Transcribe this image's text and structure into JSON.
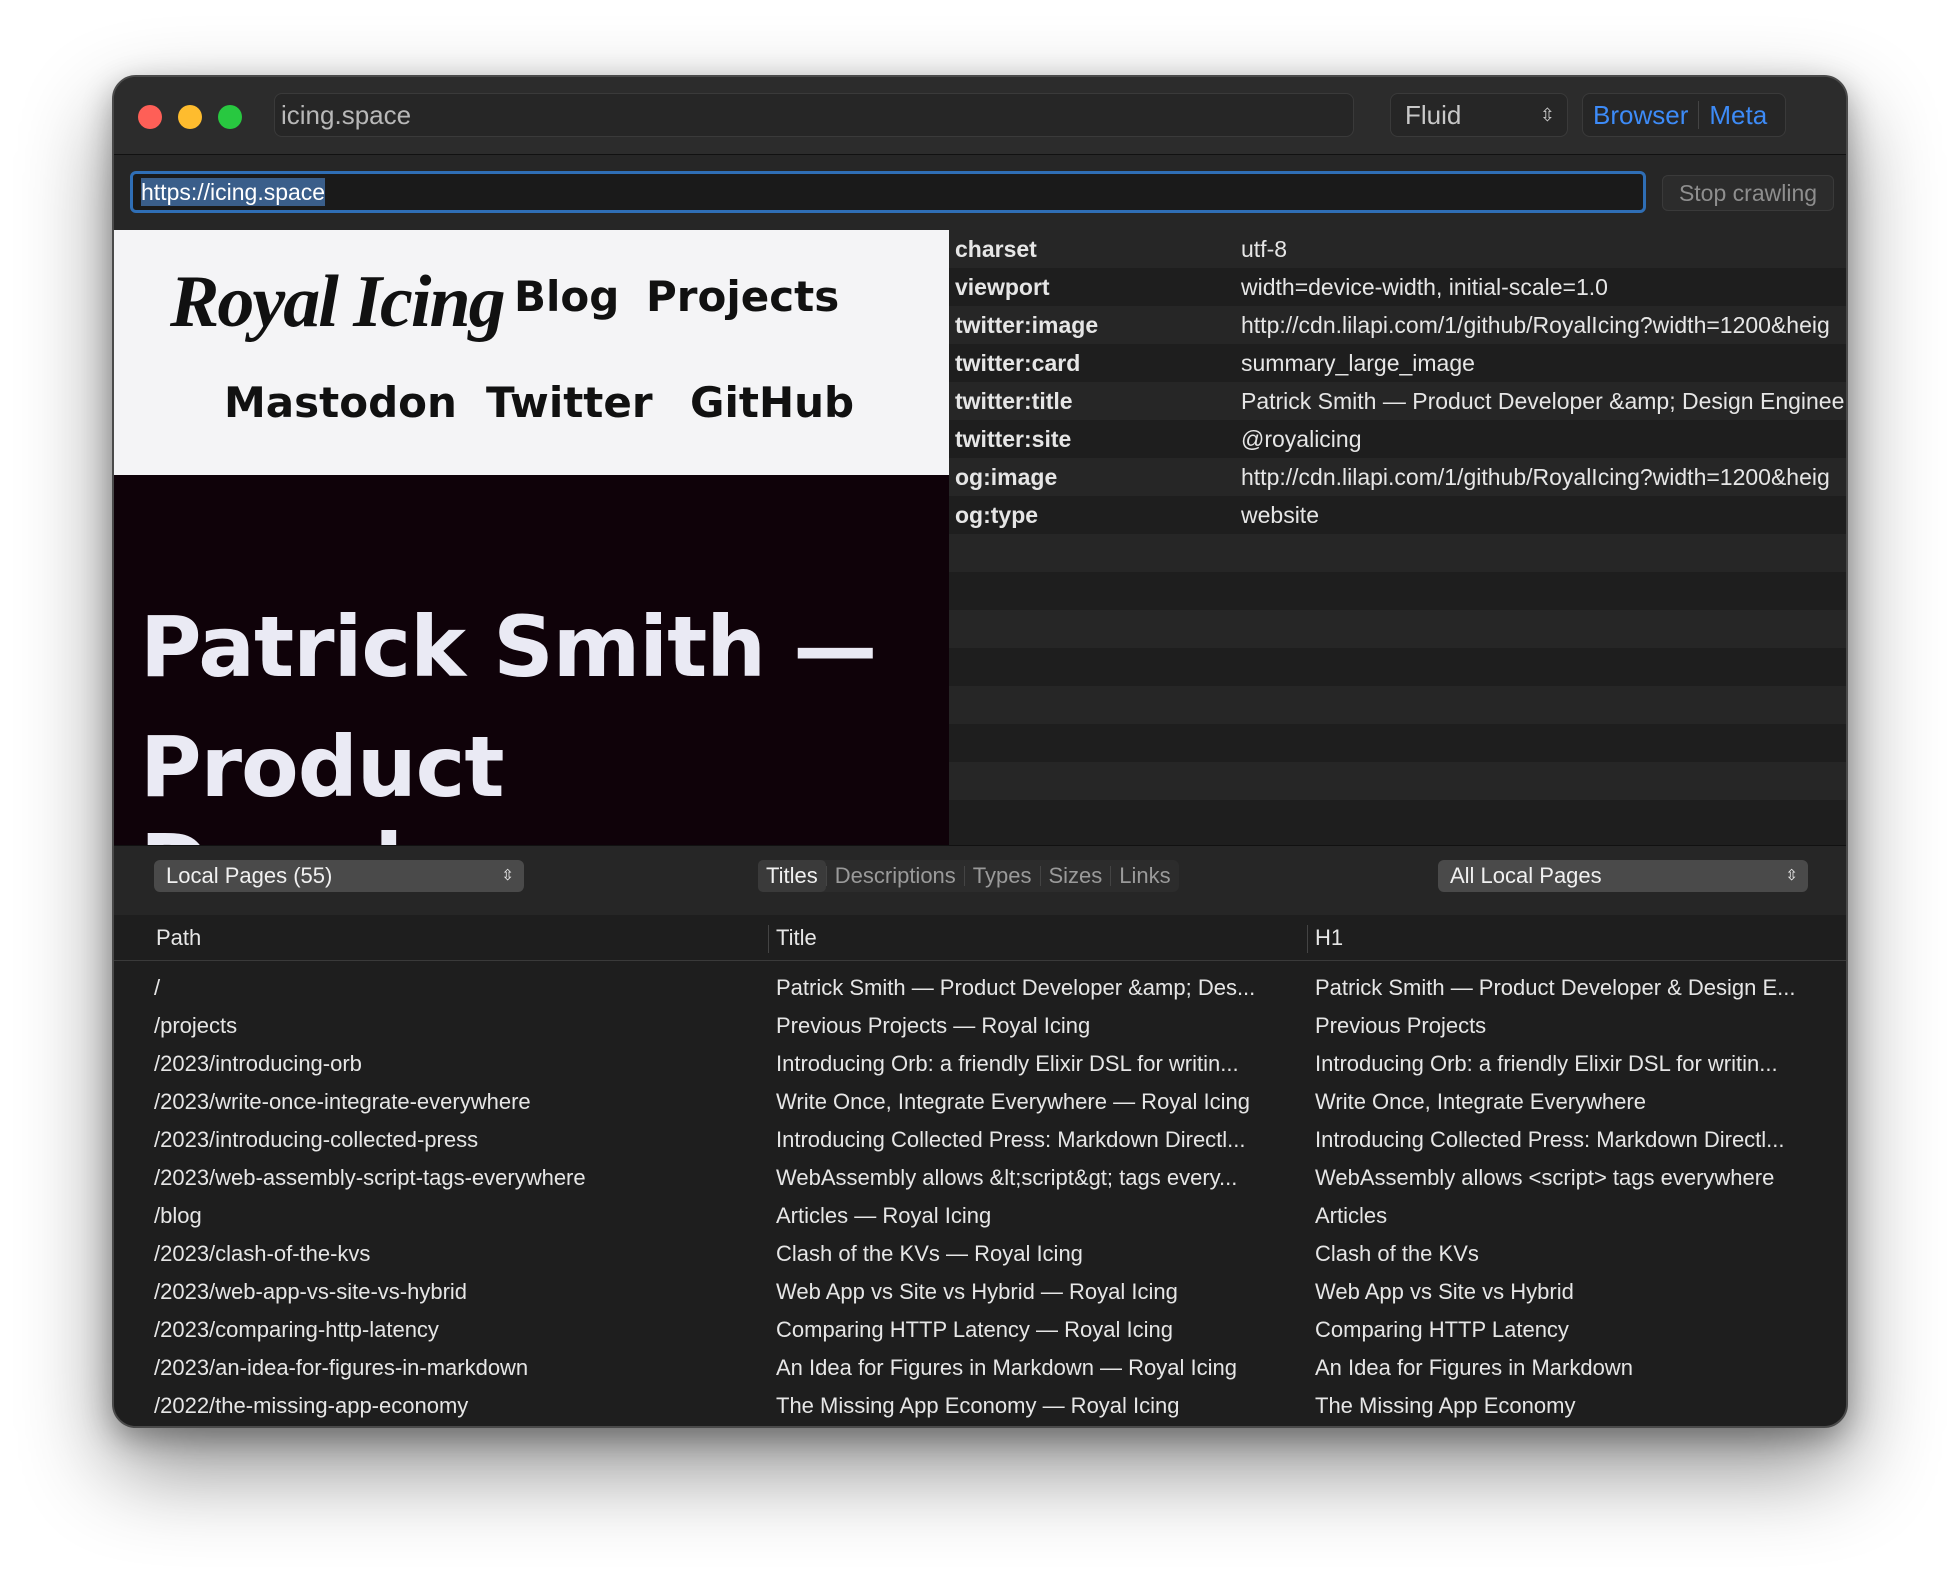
{
  "window": {
    "title_field": "icing.space",
    "mode_select": "Fluid",
    "view_browser": "Browser",
    "view_meta": "Meta"
  },
  "url_bar": {
    "url": "https://icing.space",
    "stop_label": "Stop crawling"
  },
  "preview": {
    "logo": "Royal Icing",
    "nav": [
      "Blog",
      "Projects",
      "Mastodon",
      "Twitter",
      "GitHub"
    ],
    "hero_line1": "Patrick Smith —",
    "hero_line2": "Product Developer"
  },
  "meta": [
    {
      "key": "charset",
      "value": "utf-8"
    },
    {
      "key": "viewport",
      "value": "width=device-width, initial-scale=1.0"
    },
    {
      "key": "twitter:image",
      "value": "http://cdn.lilapi.com/1/github/RoyalIcing?width=1200&heig"
    },
    {
      "key": "twitter:card",
      "value": "summary_large_image"
    },
    {
      "key": "twitter:title",
      "value": "Patrick Smith — Product Developer &amp; Design Enginee"
    },
    {
      "key": "twitter:site",
      "value": "@royalicing"
    },
    {
      "key": "og:image",
      "value": "http://cdn.lilapi.com/1/github/RoyalIcing?width=1200&heig"
    },
    {
      "key": "og:type",
      "value": "website"
    }
  ],
  "controls": {
    "pages_select": "Local Pages (55)",
    "tabs": [
      "Titles",
      "Descriptions",
      "Types",
      "Sizes",
      "Links"
    ],
    "active_tab": "Titles",
    "filter_select": "All Local Pages"
  },
  "table": {
    "headers": [
      "Path",
      "Title",
      "H1"
    ],
    "rows": [
      [
        "/",
        "Patrick Smith — Product Developer &amp; Des...",
        "Patrick Smith — Product Developer & Design E..."
      ],
      [
        "/projects",
        "Previous Projects — Royal Icing",
        "Previous Projects"
      ],
      [
        "/2023/introducing-orb",
        "Introducing Orb: a friendly Elixir DSL for writin...",
        "Introducing Orb: a friendly Elixir DSL for writin..."
      ],
      [
        "/2023/write-once-integrate-everywhere",
        "Write Once, Integrate Everywhere — Royal Icing",
        "Write Once, Integrate Everywhere"
      ],
      [
        "/2023/introducing-collected-press",
        "Introducing Collected Press: Markdown Directl...",
        "Introducing Collected Press: Markdown Directl..."
      ],
      [
        "/2023/web-assembly-script-tags-everywhere",
        "WebAssembly allows &lt;script&gt; tags every...",
        "WebAssembly allows <script> tags everywhere"
      ],
      [
        "/blog",
        "Articles — Royal Icing",
        "Articles"
      ],
      [
        "/2023/clash-of-the-kvs",
        "Clash of the KVs — Royal Icing",
        "Clash of the KVs"
      ],
      [
        "/2023/web-app-vs-site-vs-hybrid",
        "Web App vs Site vs Hybrid — Royal Icing",
        "Web App vs Site vs Hybrid"
      ],
      [
        "/2023/comparing-http-latency",
        "Comparing HTTP Latency — Royal Icing",
        "Comparing HTTP Latency"
      ],
      [
        "/2023/an-idea-for-figures-in-markdown",
        "An Idea for Figures in Markdown — Royal Icing",
        "An Idea for Figures in Markdown"
      ],
      [
        "/2022/the-missing-app-economy",
        "The Missing App Economy — Royal Icing",
        "The Missing App Economy"
      ]
    ]
  },
  "colors": {
    "accent": "#3d8bf7",
    "focus_ring": "#2f6eb5",
    "window_bg": "#1e1e1e",
    "preview_dark": "#0f0209",
    "traffic_red": "#fe5f57",
    "traffic_yellow": "#febc2e",
    "traffic_green": "#28c840"
  }
}
